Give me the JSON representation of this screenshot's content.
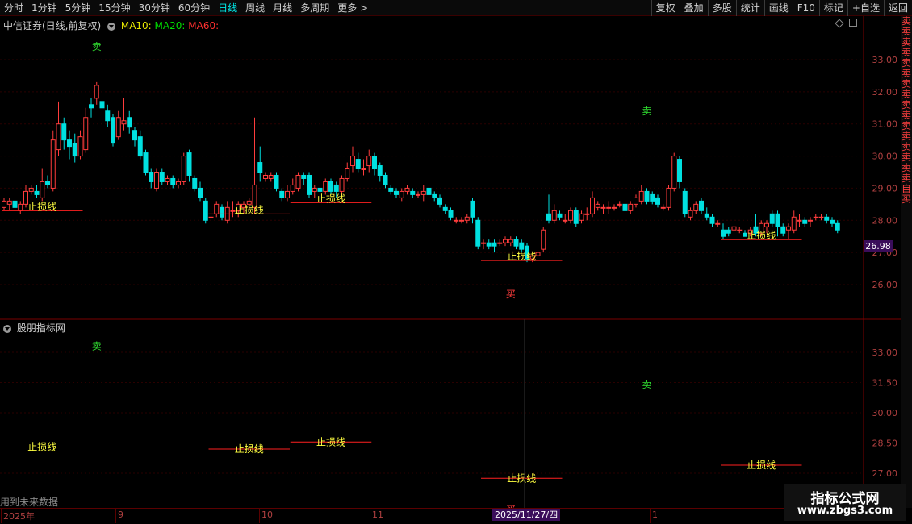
{
  "toolbar": {
    "periods": [
      "分时",
      "1分钟",
      "5分钟",
      "15分钟",
      "30分钟",
      "60分钟",
      "日线",
      "周线",
      "月线",
      "多周期",
      "更多 >"
    ],
    "active_period": "日线",
    "right_buttons": [
      "复权",
      "叠加",
      "多股",
      "统计",
      "画线",
      "F10",
      "标记",
      "+自选",
      "返回"
    ]
  },
  "main_panel": {
    "title": "中信证券(日线,前复权)",
    "ma10_label": "MA10:",
    "ma20_label": "MA20:",
    "ma60_label": "MA60:",
    "ma10_color": "#e8e800",
    "ma20_color": "#00e000",
    "ma60_color": "#ff3030",
    "y_ticks": [
      "33.00",
      "32.00",
      "31.00",
      "30.00",
      "29.00",
      "28.00",
      "27.00",
      "26.00"
    ],
    "current_price": "26.98",
    "sell_label": "卖",
    "buy_label": "买",
    "stop_label": "止损线"
  },
  "sub_panel": {
    "title": "股朋指标网",
    "y_ticks": [
      "33.00",
      "31.50",
      "30.00",
      "28.50",
      "27.00"
    ],
    "future_data_note": "用到未来数据"
  },
  "x_axis": {
    "labels": [
      "2025年",
      "9",
      "10",
      "11",
      "1"
    ],
    "cursor_date": "2025/11/27/四"
  },
  "side_strip": [
    "卖",
    "卖",
    "卖",
    "卖",
    "卖",
    "卖",
    "卖",
    "卖",
    "卖",
    "卖",
    "卖",
    "卖",
    "卖",
    "卖",
    "卖",
    "卖",
    "自",
    "买"
  ],
  "watermark": {
    "title": "指标公式网",
    "url": "www.zbgs3.com"
  },
  "chart_data": {
    "type": "candlestick",
    "title": "中信证券(日线,前复权)",
    "ylim": [
      25.2,
      33.7
    ],
    "candles": [
      [
        28.4,
        28.6,
        28.3,
        28.7
      ],
      [
        28.5,
        28.6,
        28.3,
        28.7
      ],
      [
        28.6,
        28.4,
        28.3,
        28.7
      ],
      [
        28.3,
        28.5,
        28.2,
        28.6
      ],
      [
        28.5,
        28.9,
        28.4,
        29.1
      ],
      [
        28.9,
        29.0,
        28.8,
        29.1
      ],
      [
        28.9,
        28.8,
        28.7,
        29.1
      ],
      [
        28.7,
        29.2,
        28.6,
        29.6
      ],
      [
        29.2,
        29.1,
        29.0,
        29.4
      ],
      [
        29.0,
        30.5,
        28.9,
        30.8
      ],
      [
        30.2,
        31.0,
        30.0,
        31.7
      ],
      [
        31.0,
        30.5,
        30.2,
        31.2
      ],
      [
        30.5,
        30.3,
        29.9,
        30.8
      ],
      [
        30.4,
        30.0,
        29.8,
        30.7
      ],
      [
        30.0,
        30.6,
        29.9,
        30.8
      ],
      [
        30.2,
        31.2,
        30.1,
        31.5
      ],
      [
        31.6,
        31.5,
        31.2,
        31.8
      ],
      [
        31.8,
        32.2,
        31.6,
        32.3
      ],
      [
        31.7,
        31.5,
        31.2,
        32.0
      ],
      [
        31.4,
        31.1,
        30.9,
        31.6
      ],
      [
        31.2,
        30.4,
        30.3,
        31.3
      ],
      [
        30.6,
        31.2,
        30.5,
        31.4
      ],
      [
        31.0,
        31.1,
        30.8,
        31.8
      ],
      [
        31.2,
        30.9,
        30.7,
        31.4
      ],
      [
        30.8,
        30.5,
        30.3,
        30.9
      ],
      [
        30.6,
        30.0,
        29.9,
        30.8
      ],
      [
        30.1,
        29.5,
        29.4,
        30.2
      ],
      [
        29.5,
        29.2,
        29.0,
        29.6
      ],
      [
        29.0,
        29.5,
        28.9,
        29.6
      ],
      [
        29.5,
        29.2,
        29.1,
        29.6
      ],
      [
        29.2,
        29.3,
        29.1,
        29.4
      ],
      [
        29.3,
        29.1,
        29.0,
        29.4
      ],
      [
        29.1,
        29.2,
        29.0,
        29.3
      ],
      [
        29.2,
        30.0,
        29.1,
        30.1
      ],
      [
        30.1,
        29.4,
        29.2,
        30.2
      ],
      [
        29.3,
        29.0,
        28.9,
        29.4
      ],
      [
        29.0,
        28.7,
        28.6,
        29.2
      ],
      [
        28.6,
        28.0,
        27.9,
        28.7
      ],
      [
        28.1,
        28.1,
        27.9,
        28.2
      ],
      [
        28.2,
        28.5,
        28.1,
        28.6
      ],
      [
        28.4,
        28.1,
        28.0,
        28.5
      ],
      [
        28.0,
        28.4,
        27.9,
        28.6
      ],
      [
        28.3,
        28.3,
        28.1,
        28.6
      ],
      [
        28.3,
        28.5,
        28.1,
        28.6
      ],
      [
        28.4,
        28.5,
        28.2,
        28.6
      ],
      [
        28.5,
        28.6,
        28.3,
        28.7
      ],
      [
        28.4,
        29.1,
        28.2,
        31.2
      ],
      [
        29.8,
        29.5,
        29.2,
        30.3
      ],
      [
        29.3,
        29.4,
        29.2,
        29.5
      ],
      [
        29.3,
        29.4,
        29.2,
        29.5
      ],
      [
        29.4,
        29.0,
        28.9,
        29.5
      ],
      [
        28.9,
        28.7,
        28.6,
        29.0
      ],
      [
        28.7,
        28.9,
        28.6,
        29.1
      ],
      [
        28.9,
        29.1,
        28.8,
        29.3
      ],
      [
        29.0,
        29.4,
        28.9,
        29.5
      ],
      [
        29.4,
        29.3,
        29.1,
        29.5
      ],
      [
        29.4,
        28.8,
        28.7,
        29.5
      ],
      [
        28.9,
        29.0,
        28.7,
        29.1
      ],
      [
        29.0,
        28.9,
        28.7,
        29.2
      ],
      [
        28.9,
        29.2,
        28.8,
        29.3
      ],
      [
        29.2,
        28.9,
        28.8,
        29.3
      ],
      [
        29.1,
        28.9,
        28.7,
        29.2
      ],
      [
        28.9,
        29.3,
        28.7,
        29.4
      ],
      [
        29.3,
        29.6,
        29.2,
        29.8
      ],
      [
        29.7,
        30.0,
        29.5,
        30.3
      ],
      [
        29.9,
        29.6,
        29.5,
        30.1
      ],
      [
        29.6,
        29.6,
        29.4,
        29.9
      ],
      [
        29.7,
        30.0,
        29.5,
        30.2
      ],
      [
        30.0,
        29.6,
        29.4,
        30.1
      ],
      [
        29.7,
        29.4,
        29.2,
        29.8
      ],
      [
        29.4,
        29.1,
        29.0,
        29.5
      ],
      [
        29.0,
        28.9,
        28.8,
        29.1
      ],
      [
        28.9,
        28.8,
        28.7,
        29.0
      ],
      [
        28.7,
        28.9,
        28.6,
        29.0
      ],
      [
        28.9,
        29.0,
        28.8,
        29.1
      ],
      [
        28.9,
        28.8,
        28.7,
        29.0
      ],
      [
        28.8,
        28.8,
        28.7,
        28.9
      ],
      [
        28.8,
        28.9,
        28.6,
        29.1
      ],
      [
        29.0,
        28.8,
        28.7,
        29.1
      ],
      [
        28.8,
        28.7,
        28.6,
        28.9
      ],
      [
        28.7,
        28.5,
        28.4,
        28.8
      ],
      [
        28.4,
        28.3,
        28.2,
        28.5
      ],
      [
        28.3,
        28.1,
        28.0,
        28.4
      ],
      [
        28.0,
        28.0,
        27.9,
        28.1
      ],
      [
        28.0,
        28.0,
        27.9,
        28.1
      ],
      [
        28.0,
        28.1,
        27.9,
        28.2
      ],
      [
        28.6,
        28.1,
        27.9,
        28.7
      ],
      [
        28.0,
        27.2,
        27.1,
        28.1
      ],
      [
        27.3,
        27.3,
        27.1,
        27.4
      ],
      [
        27.3,
        27.2,
        27.1,
        27.4
      ],
      [
        27.3,
        27.2,
        27.0,
        27.4
      ],
      [
        27.3,
        27.3,
        27.2,
        27.4
      ],
      [
        27.3,
        27.4,
        27.2,
        27.5
      ],
      [
        27.3,
        27.4,
        27.2,
        27.5
      ],
      [
        27.4,
        27.2,
        27.1,
        27.5
      ],
      [
        27.3,
        27.1,
        27.0,
        27.4
      ],
      [
        27.2,
        26.8,
        26.7,
        27.3
      ],
      [
        26.8,
        26.9,
        26.7,
        27.0
      ],
      [
        26.9,
        27.0,
        26.8,
        27.3
      ],
      [
        27.1,
        27.7,
        27.0,
        27.8
      ],
      [
        28.2,
        28.0,
        27.9,
        28.8
      ],
      [
        28.0,
        28.3,
        27.9,
        28.5
      ],
      [
        28.2,
        28.1,
        28.0,
        28.3
      ],
      [
        28.0,
        28.0,
        27.9,
        28.2
      ],
      [
        28.0,
        28.3,
        27.9,
        28.4
      ],
      [
        28.3,
        27.9,
        27.8,
        28.4
      ],
      [
        28.0,
        28.2,
        27.9,
        28.3
      ],
      [
        28.2,
        28.2,
        28.0,
        28.4
      ],
      [
        28.2,
        28.7,
        28.1,
        28.9
      ],
      [
        28.4,
        28.5,
        28.3,
        28.6
      ],
      [
        28.4,
        28.4,
        28.2,
        28.5
      ],
      [
        28.4,
        28.4,
        28.2,
        28.6
      ],
      [
        28.4,
        28.4,
        28.3,
        28.5
      ],
      [
        28.5,
        28.5,
        28.4,
        28.6
      ],
      [
        28.5,
        28.3,
        28.2,
        28.6
      ],
      [
        28.3,
        28.5,
        28.2,
        28.6
      ],
      [
        28.5,
        28.7,
        28.4,
        28.8
      ],
      [
        28.6,
        28.9,
        28.5,
        29.1
      ],
      [
        28.9,
        28.6,
        28.5,
        29.0
      ],
      [
        28.8,
        28.6,
        28.5,
        28.9
      ],
      [
        28.7,
        28.5,
        28.4,
        28.8
      ],
      [
        28.4,
        28.4,
        28.3,
        28.5
      ],
      [
        28.4,
        29.0,
        28.3,
        29.1
      ],
      [
        29.0,
        30.0,
        28.9,
        30.1
      ],
      [
        29.9,
        29.2,
        29.0,
        30.0
      ],
      [
        28.9,
        28.2,
        28.1,
        29.0
      ],
      [
        28.1,
        28.3,
        28.0,
        28.4
      ],
      [
        28.3,
        28.5,
        28.2,
        28.6
      ],
      [
        28.6,
        28.3,
        28.2,
        28.7
      ],
      [
        28.2,
        28.1,
        28.0,
        28.4
      ],
      [
        28.1,
        27.9,
        27.8,
        28.2
      ],
      [
        27.9,
        27.9,
        27.8,
        28.0
      ],
      [
        27.7,
        27.5,
        27.4,
        27.9
      ],
      [
        27.7,
        27.6,
        27.5,
        27.8
      ],
      [
        27.7,
        27.8,
        27.6,
        27.9
      ],
      [
        27.7,
        27.7,
        27.6,
        27.8
      ],
      [
        27.6,
        27.5,
        27.5,
        27.7
      ],
      [
        27.6,
        27.7,
        27.5,
        27.8
      ],
      [
        27.8,
        27.6,
        27.5,
        28.2
      ],
      [
        27.6,
        27.9,
        27.5,
        28.0
      ],
      [
        27.8,
        27.9,
        27.6,
        28.0
      ],
      [
        28.2,
        27.9,
        27.8,
        28.3
      ],
      [
        28.2,
        27.8,
        27.5,
        28.3
      ],
      [
        27.8,
        27.6,
        27.5,
        27.9
      ],
      [
        27.7,
        27.8,
        27.4,
        27.9
      ],
      [
        27.7,
        28.1,
        27.6,
        28.3
      ],
      [
        28.0,
        28.0,
        27.8,
        28.2
      ],
      [
        28.0,
        27.9,
        27.8,
        28.1
      ],
      [
        28.0,
        28.0,
        27.8,
        28.1
      ],
      [
        28.1,
        28.1,
        28.0,
        28.2
      ],
      [
        28.1,
        28.1,
        28.0,
        28.2
      ],
      [
        28.1,
        28.0,
        27.9,
        28.2
      ],
      [
        28.0,
        27.9,
        27.8,
        28.1
      ],
      [
        27.9,
        27.7,
        27.6,
        28.0
      ]
    ],
    "stop_lines": [
      {
        "label": "止损线",
        "start": 0,
        "end": 14,
        "value": 28.3
      },
      {
        "label": "止损线",
        "start": 38,
        "end": 52,
        "value": 28.2
      },
      {
        "label": "止损线",
        "start": 53,
        "end": 67,
        "value": 28.55
      },
      {
        "label": "止损线",
        "start": 88,
        "end": 102,
        "value": 26.75
      },
      {
        "label": "止损线",
        "start": 132,
        "end": 146,
        "value": 27.4
      }
    ],
    "signals": [
      {
        "label": "卖",
        "index": 17,
        "value": 33.4
      },
      {
        "label": "卖",
        "index": 118,
        "value": 31.4
      },
      {
        "label": "买",
        "index": 93,
        "value": 25.7
      }
    ]
  }
}
